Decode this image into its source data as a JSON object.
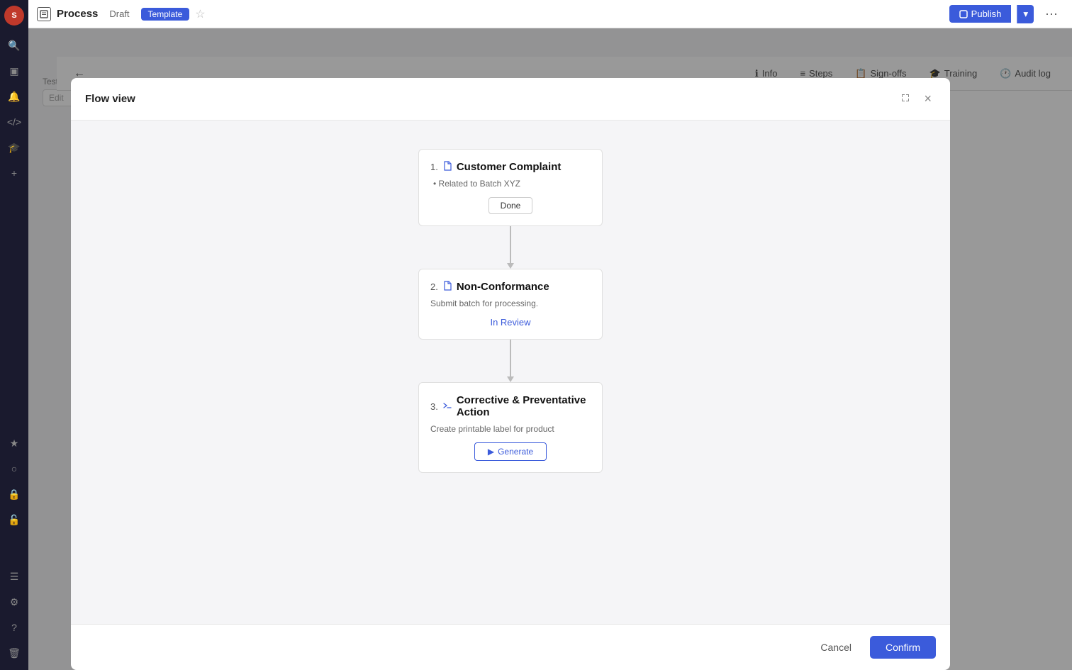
{
  "app": {
    "logo_text": "S",
    "process_label": "Process",
    "draft_label": "Draft",
    "template_label": "Template",
    "publish_label": "Publish",
    "more_label": "···"
  },
  "secondbar": {
    "back_label": "←",
    "tabs": [
      {
        "id": "info",
        "label": "Info",
        "icon": "ℹ"
      },
      {
        "id": "steps",
        "label": "Steps",
        "icon": "≡"
      },
      {
        "id": "signoffs",
        "label": "Sign-offs",
        "icon": "📋"
      },
      {
        "id": "training",
        "label": "Training",
        "icon": "🎓"
      },
      {
        "id": "auditlog",
        "label": "Audit log",
        "icon": "🕐"
      }
    ]
  },
  "sidebar": {
    "icons": [
      {
        "id": "search",
        "symbol": "🔍"
      },
      {
        "id": "inbox",
        "symbol": "📥"
      },
      {
        "id": "bell",
        "symbol": "🔔"
      },
      {
        "id": "code",
        "symbol": "<>"
      },
      {
        "id": "graduation",
        "symbol": "🎓"
      },
      {
        "id": "plus",
        "symbol": "+"
      },
      {
        "id": "star",
        "symbol": "★"
      },
      {
        "id": "globe",
        "symbol": "🌐"
      },
      {
        "id": "lock",
        "symbol": "🔒"
      },
      {
        "id": "lock2",
        "symbol": "🔒"
      },
      {
        "id": "list",
        "symbol": "☰"
      },
      {
        "id": "gear",
        "symbol": "⚙"
      },
      {
        "id": "question",
        "symbol": "?"
      },
      {
        "id": "trash",
        "symbol": "🗑"
      }
    ]
  },
  "modal": {
    "title": "Flow view",
    "close_label": "×",
    "cancel_label": "Cancel",
    "confirm_label": "Confirm",
    "steps": [
      {
        "number": "1.",
        "icon": "doc",
        "title": "Customer Complaint",
        "subtitle": "Related to Batch XYZ",
        "description": "",
        "action_type": "done",
        "action_label": "Done"
      },
      {
        "number": "2.",
        "icon": "doc",
        "title": "Non-Conformance",
        "subtitle": "",
        "description": "Submit batch for processing.",
        "action_type": "inreview",
        "action_label": "In Review"
      },
      {
        "number": "3.",
        "icon": "code",
        "title": "Corrective & Preventative Action",
        "subtitle": "",
        "description": "Create printable label for product",
        "action_type": "generate",
        "action_label": "Generate"
      }
    ]
  },
  "background": {
    "field_label": "Test tube ID",
    "field_placeholder": "Edit"
  }
}
